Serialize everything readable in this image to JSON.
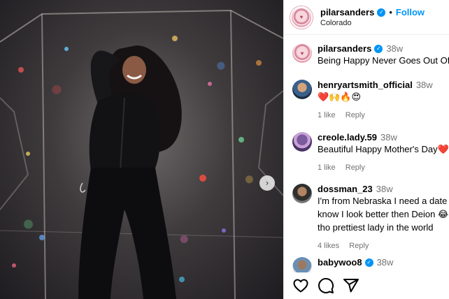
{
  "post": {
    "username": "pilarsanders",
    "follow_label": "Follow",
    "location": "Colorado",
    "separator": "•"
  },
  "caption": {
    "username": "pilarsanders",
    "time": "38w",
    "text": "Being Happy Never Goes Out Of S"
  },
  "comments": [
    {
      "username": "henryartsmith_official",
      "time": "38w",
      "text": "❤️🙌🔥😍",
      "likes": "1 like",
      "reply": "Reply"
    },
    {
      "username": "creole.lady.59",
      "time": "38w",
      "text": "Beautiful Happy Mother's Day❤️💋",
      "likes": "1 like",
      "reply": "Reply"
    },
    {
      "username": "dossman_23",
      "time": "38w",
      "text_lines": [
        "I'm from Nebraska I need a date l",
        "know I look better then Deion 😂 f",
        "tho prettiest lady in the world"
      ],
      "likes": "4 likes",
      "reply": "Reply"
    },
    {
      "username": "babywoo8",
      "time": "38w"
    }
  ],
  "icons": {
    "like": "heart-icon",
    "comment": "comment-icon",
    "share": "share-icon",
    "carousel_next": "chevron-right-icon",
    "verified": "verified-badge-icon"
  },
  "colors": {
    "accent": "#0095f6",
    "muted": "#737373"
  }
}
